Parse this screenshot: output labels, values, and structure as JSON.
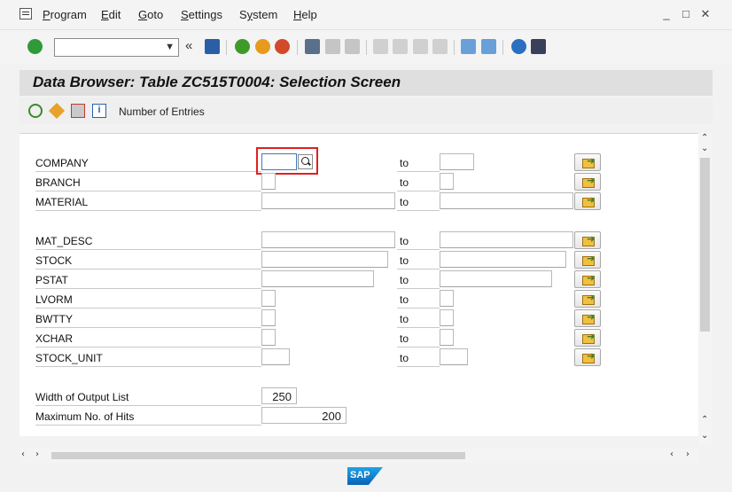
{
  "menu": {
    "items": [
      "Program",
      "Edit",
      "Goto",
      "Settings",
      "System",
      "Help"
    ],
    "underline_first": [
      "P",
      "E",
      "G",
      "S",
      "y",
      "H"
    ],
    "window_controls": [
      "_",
      "□",
      "✕"
    ]
  },
  "toolbar": {
    "command_field": "",
    "back_symbol": "«"
  },
  "title": "Data Browser: Table ZC515T0004: Selection Screen",
  "app_toolbar": {
    "number_of_entries": "Number of Entries"
  },
  "selection": {
    "to_label": "to",
    "rows": [
      {
        "label": "COMPANY"
      },
      {
        "label": "BRANCH"
      },
      {
        "label": "MATERIAL"
      },
      {
        "label": "MAT_DESC"
      },
      {
        "label": "STOCK"
      },
      {
        "label": "PSTAT"
      },
      {
        "label": "LVORM"
      },
      {
        "label": "BWTTY"
      },
      {
        "label": "XCHAR"
      },
      {
        "label": "STOCK_UNIT"
      }
    ],
    "width_of_output_list": {
      "label": "Width of Output List",
      "value": "250"
    },
    "maximum_no_of_hits": {
      "label": "Maximum No. of Hits",
      "value": "200"
    }
  },
  "status": {
    "logo": "SAP"
  },
  "colors": {
    "highlight": "#e02020",
    "title_bg": "#dfdfdf",
    "sap_blue": "#0a63b5"
  }
}
